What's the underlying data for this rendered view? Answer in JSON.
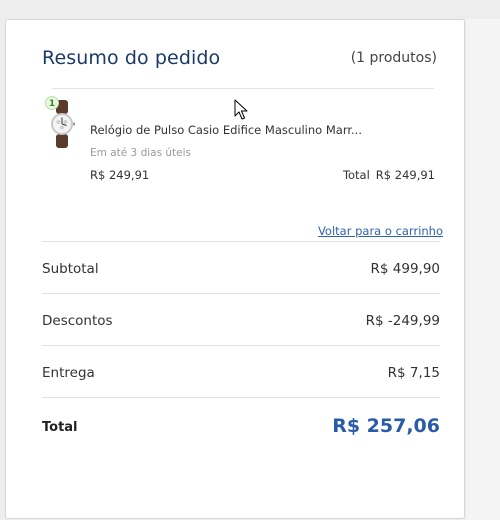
{
  "summary": {
    "title": "Resumo do pedido",
    "count": "(1 produtos)"
  },
  "product": {
    "quantity": "1",
    "name": "Relógio de Pulso Casio Edifice Masculino Marr...",
    "delivery": "Em até 3 dias úteis",
    "unit_price": "R$ 249,91",
    "total_label": "Total",
    "total_value": "R$ 249,91",
    "image_icon": "wristwatch-icon"
  },
  "back_link": "Voltar para o carrinho",
  "rows": [
    {
      "label": "Subtotal",
      "value": "R$ 499,90"
    },
    {
      "label": "Descontos",
      "value": "R$ -249,99"
    },
    {
      "label": "Entrega",
      "value": "R$ 7,15"
    }
  ],
  "total": {
    "label": "Total",
    "value": "R$ 257,06"
  },
  "colors": {
    "title": "#1b3a66",
    "link": "#2f63b0",
    "total_value": "#2a5ba8",
    "badge_bg": "#eaf6e3"
  }
}
